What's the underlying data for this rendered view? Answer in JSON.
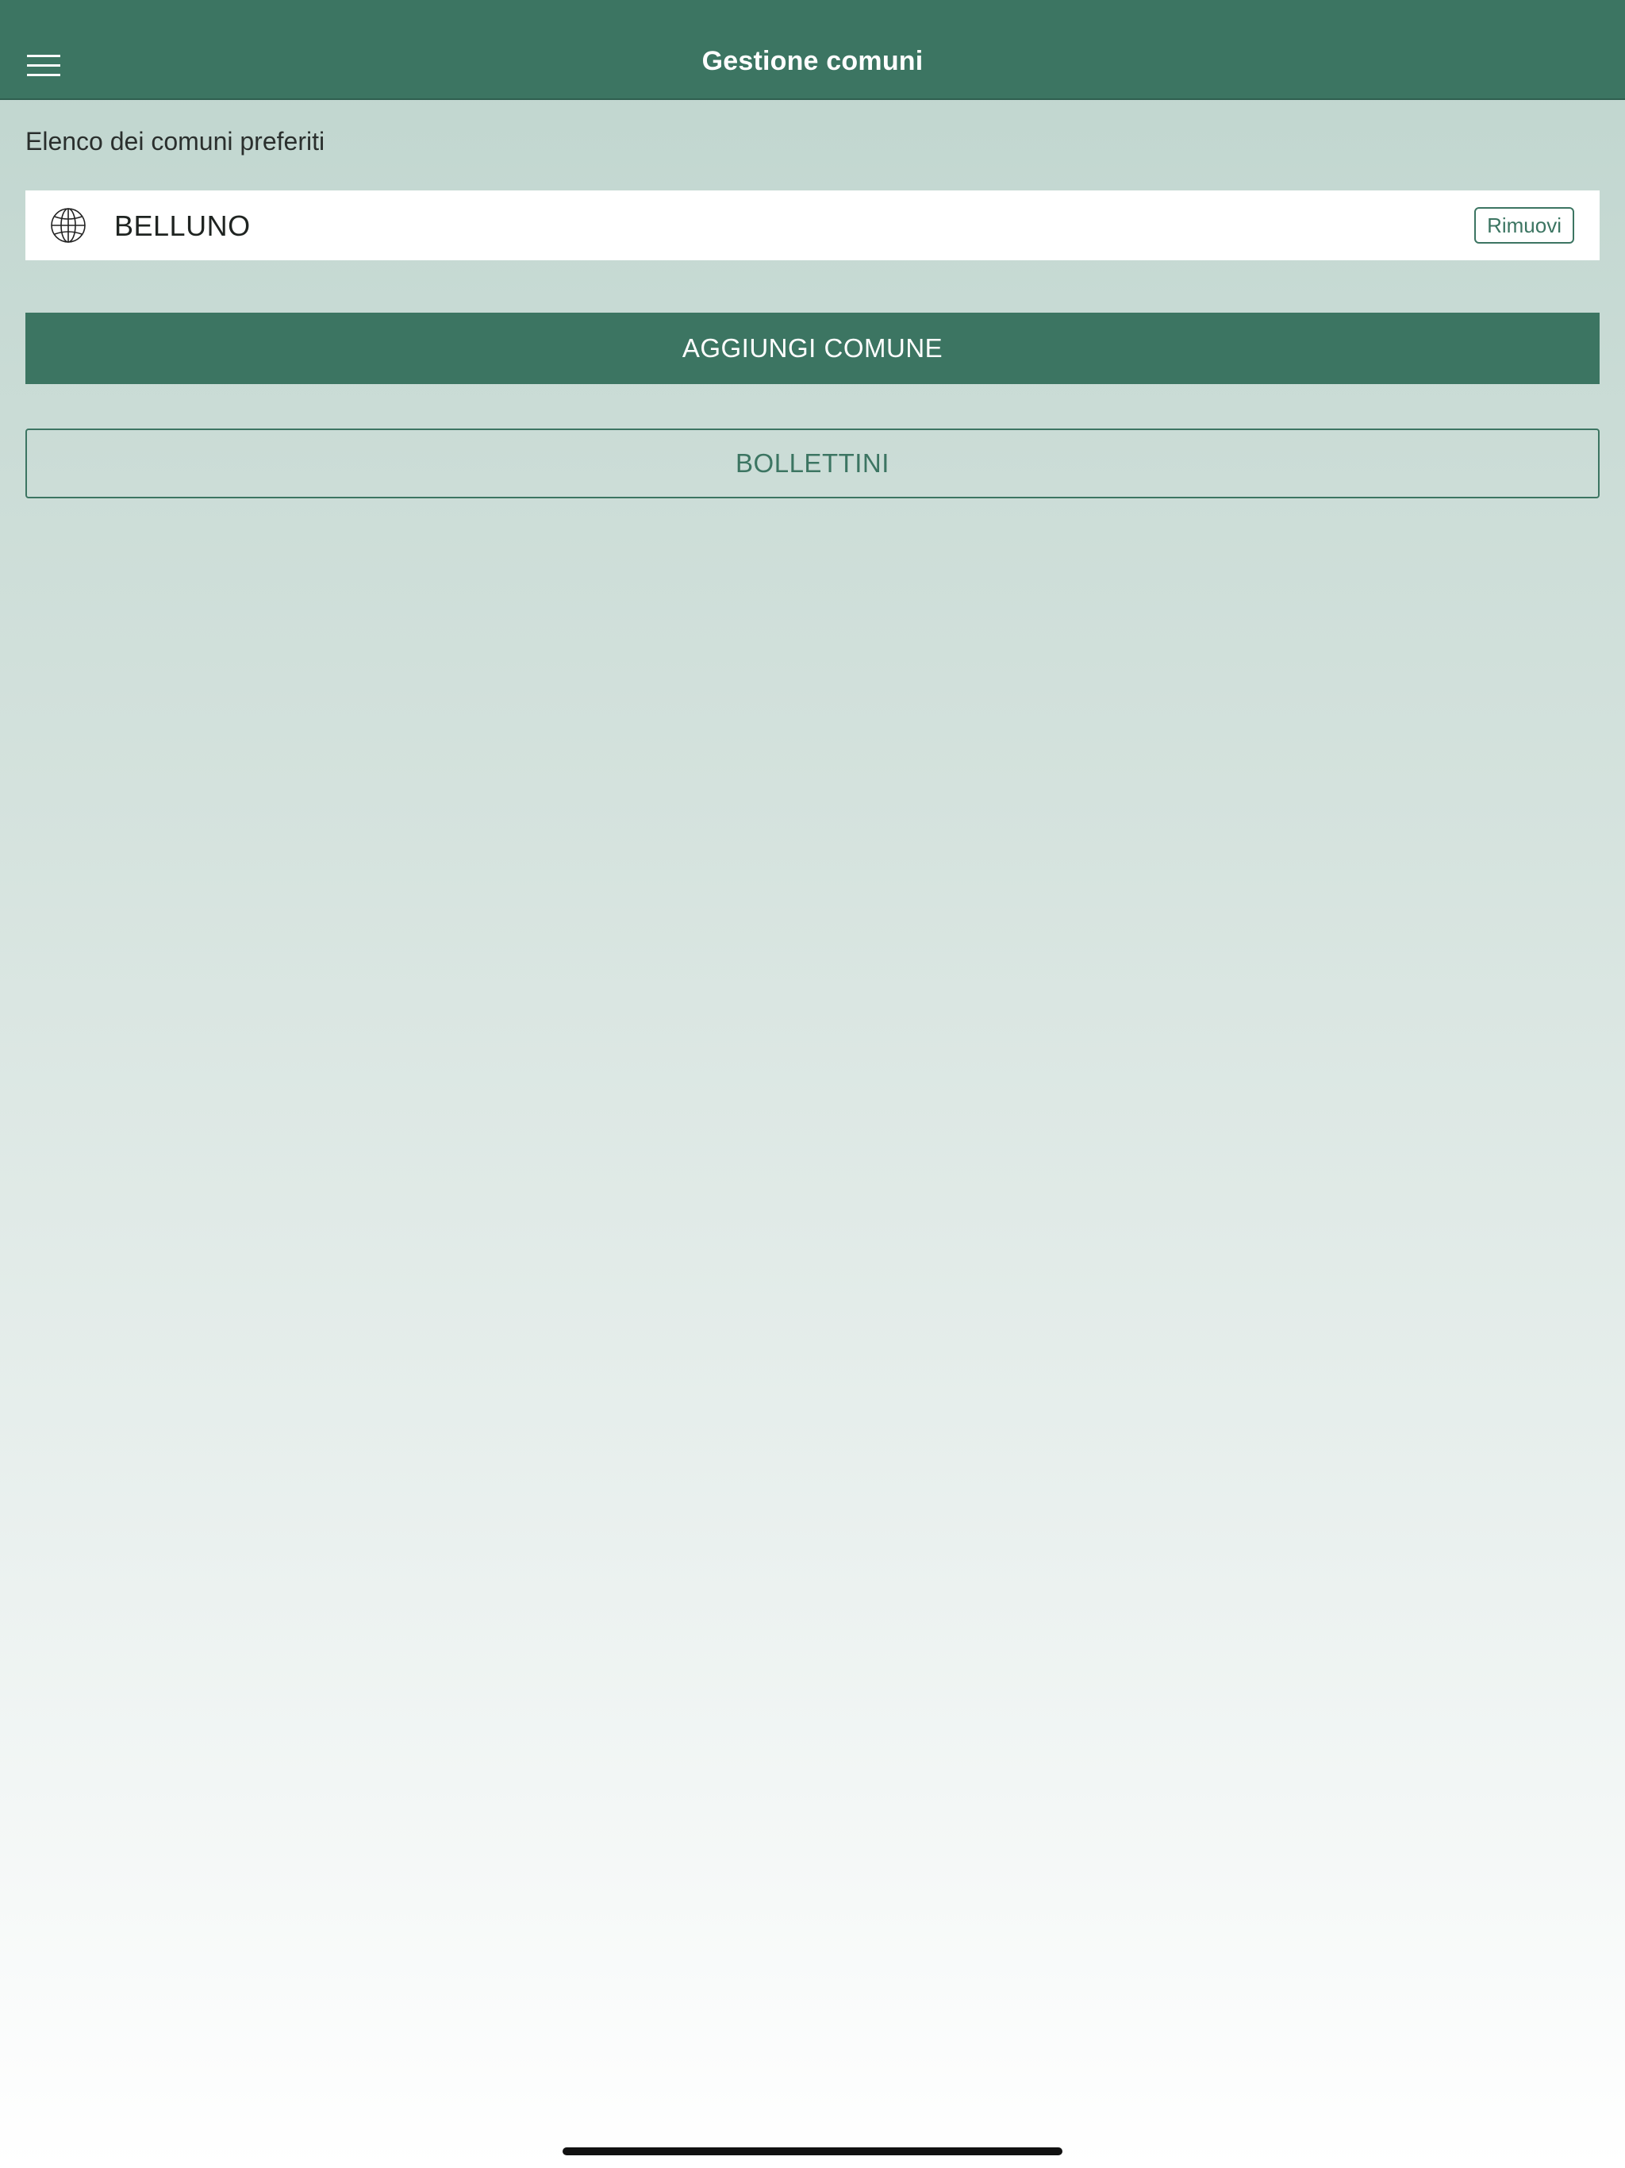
{
  "header": {
    "title": "Gestione comuni",
    "menu_icon": "hamburger-menu-icon"
  },
  "favorites": {
    "section_label": "Elenco dei comuni preferiti",
    "items": [
      {
        "icon": "globe-icon",
        "name": "BELLUNO",
        "remove_label": "Rimuovi"
      }
    ]
  },
  "actions": {
    "add_label": "AGGIUNGI COMUNE",
    "bulletins_label": "BOLLETTINI"
  },
  "colors": {
    "primary": "#3c7562",
    "background_top": "#bfd5ce",
    "background_bottom": "#ffffff"
  }
}
